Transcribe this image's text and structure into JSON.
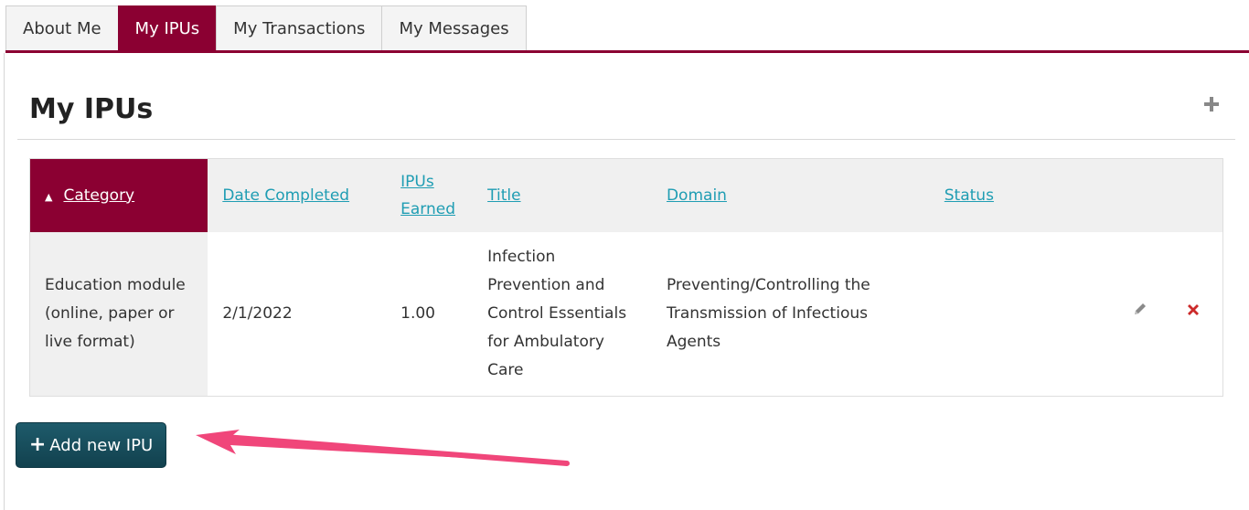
{
  "tabs": [
    {
      "label": "About Me",
      "active": false
    },
    {
      "label": "My IPUs",
      "active": true
    },
    {
      "label": "My Transactions",
      "active": false
    },
    {
      "label": "My Messages",
      "active": false
    }
  ],
  "page": {
    "title": "My IPUs",
    "add_icon": "plus-icon"
  },
  "table": {
    "sort_indicator": "▲",
    "columns": [
      "Category",
      "Date Completed",
      "IPUs Earned",
      "Title",
      "Domain",
      "Status"
    ],
    "rows": [
      {
        "category": "Education module (online, paper or live format)",
        "date": "2/1/2022",
        "ipus": "1.00",
        "title": "Infection Prevention and Control Essentials for Ambulatory Care",
        "domain": "Preventing/Controlling the Transmission of Infectious Agents",
        "status": ""
      }
    ],
    "icons": {
      "edit": "pencil-icon",
      "delete": "close-x-icon"
    }
  },
  "add_button": {
    "icon": "plus-icon",
    "label": "Add new IPU"
  },
  "colors": {
    "brand": "#8b0032",
    "link": "#1f9db3",
    "button": "#1a5060",
    "delete": "#cc2a2a",
    "annotation_arrow": "#f0467a"
  }
}
